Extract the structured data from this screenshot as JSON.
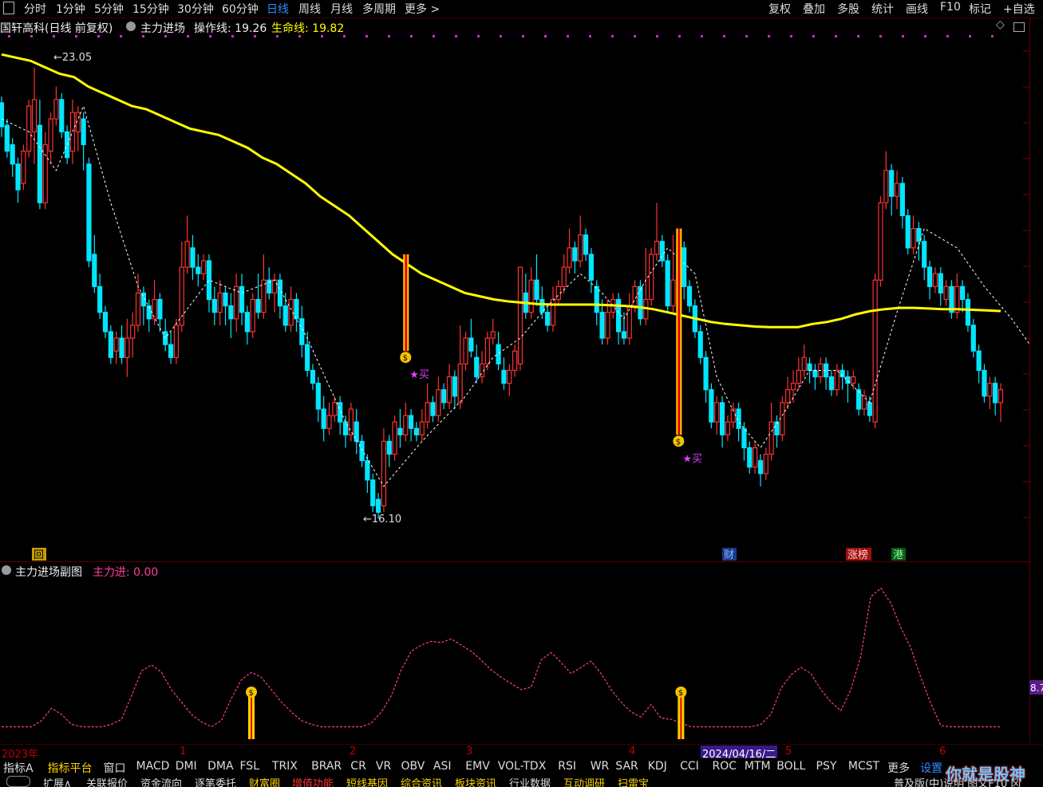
{
  "topbar": {
    "menu_icon": "square-menu-icon",
    "periods": [
      "分时",
      "1分钟",
      "5分钟",
      "15分钟",
      "30分钟",
      "60分钟",
      "日线",
      "周线",
      "月线",
      "多周期",
      "更多 >"
    ],
    "selected": "日线",
    "right": [
      "复权",
      "叠加",
      "多股",
      "统计",
      "画线",
      "F10",
      "标记",
      "+自选"
    ]
  },
  "info": {
    "stock": "国轩高科(日线 前复权)",
    "indicator": "主力进场",
    "op_line": "操作线: 19.26",
    "life_line": "生命线: 19.82"
  },
  "chart_data": {
    "type": "candlestick",
    "price_high_label": "23.05",
    "price_low_label": "16.10",
    "buy_label": "★买",
    "markers": [
      "回",
      "财",
      "涨榜",
      "港"
    ],
    "date_label": "2024/04/16/二",
    "months": [
      "2023年",
      "1",
      "2",
      "3",
      "4",
      "5",
      "6"
    ],
    "sub_title": "主力进场副图",
    "sub_value": "主力进: 0.00",
    "sub_axis_label": "8.7",
    "candles": [
      [
        22.55,
        22.18,
        22.65,
        22.02
      ],
      [
        22.2,
        21.8,
        22.3,
        21.7
      ],
      [
        21.9,
        21.6,
        22.0,
        21.4
      ],
      [
        21.6,
        21.2,
        21.7,
        21.0
      ],
      [
        21.3,
        21.8,
        21.9,
        21.2
      ],
      [
        21.8,
        22.5,
        22.6,
        21.7
      ],
      [
        22.1,
        22.6,
        23.1,
        21.6
      ],
      [
        22.2,
        21.0,
        22.6,
        20.9
      ],
      [
        21.0,
        21.9,
        22.1,
        20.9
      ],
      [
        21.8,
        22.3,
        22.4,
        21.6
      ],
      [
        22.3,
        22.6,
        22.8,
        22.2
      ],
      [
        22.6,
        22.1,
        22.7,
        22.0
      ],
      [
        22.1,
        21.7,
        22.2,
        21.6
      ],
      [
        21.8,
        22.4,
        22.6,
        21.6
      ],
      [
        22.1,
        22.4,
        22.5,
        21.8
      ],
      [
        22.3,
        21.9,
        22.4,
        21.5
      ],
      [
        21.6,
        20.1,
        21.7,
        20.0
      ],
      [
        20.2,
        19.7,
        20.5,
        19.6
      ],
      [
        19.7,
        19.3,
        19.9,
        19.2
      ],
      [
        19.3,
        19.0,
        19.4,
        18.9
      ],
      [
        19.0,
        18.6,
        19.1,
        18.5
      ],
      [
        18.7,
        18.9,
        19.0,
        18.5
      ],
      [
        18.9,
        18.6,
        19.1,
        18.5
      ],
      [
        18.6,
        18.9,
        19.2,
        18.3
      ],
      [
        18.9,
        19.1,
        19.3,
        18.6
      ],
      [
        19.1,
        19.6,
        19.9,
        19.0
      ],
      [
        19.6,
        19.4,
        19.7,
        19.1
      ],
      [
        19.4,
        19.2,
        19.5,
        19.0
      ],
      [
        19.2,
        19.5,
        19.8,
        19.1
      ],
      [
        19.5,
        19.2,
        19.6,
        19.0
      ],
      [
        19.0,
        18.8,
        19.2,
        18.7
      ],
      [
        18.8,
        18.6,
        19.0,
        18.5
      ],
      [
        18.6,
        19.1,
        19.2,
        18.5
      ],
      [
        19.1,
        20.0,
        20.4,
        19.0
      ],
      [
        20.0,
        20.4,
        20.8,
        19.9
      ],
      [
        20.3,
        20.0,
        20.5,
        19.8
      ],
      [
        20.0,
        19.9,
        20.2,
        19.7
      ],
      [
        19.9,
        20.1,
        20.2,
        19.8
      ],
      [
        20.1,
        19.5,
        20.2,
        19.3
      ],
      [
        19.5,
        19.3,
        19.7,
        19.1
      ],
      [
        19.3,
        19.6,
        19.8,
        19.1
      ],
      [
        19.6,
        19.4,
        19.7,
        19.1
      ],
      [
        19.4,
        19.2,
        19.6,
        18.9
      ],
      [
        19.2,
        19.7,
        19.9,
        19.0
      ],
      [
        19.7,
        19.3,
        19.9,
        19.1
      ],
      [
        19.3,
        19.0,
        19.4,
        18.8
      ],
      [
        19.0,
        19.5,
        19.6,
        18.9
      ],
      [
        19.5,
        19.3,
        19.9,
        19.2
      ],
      [
        19.3,
        19.8,
        20.2,
        19.2
      ],
      [
        19.8,
        19.6,
        20.0,
        19.5
      ],
      [
        19.6,
        19.8,
        19.9,
        19.3
      ],
      [
        19.8,
        19.4,
        19.9,
        19.2
      ],
      [
        19.4,
        19.1,
        19.6,
        19.0
      ],
      [
        19.1,
        19.5,
        19.7,
        19.0
      ],
      [
        19.5,
        19.2,
        19.6,
        19.0
      ],
      [
        19.2,
        18.8,
        19.4,
        18.6
      ],
      [
        18.8,
        18.4,
        19.0,
        18.3
      ],
      [
        18.4,
        18.2,
        18.5,
        18.1
      ],
      [
        18.2,
        17.8,
        18.3,
        17.6
      ],
      [
        17.8,
        17.5,
        18.0,
        17.3
      ],
      [
        17.5,
        17.7,
        17.9,
        17.4
      ],
      [
        17.7,
        17.9,
        18.0,
        17.6
      ],
      [
        17.9,
        17.6,
        18.0,
        17.4
      ],
      [
        17.6,
        17.4,
        17.7,
        17.2
      ],
      [
        17.4,
        17.8,
        17.9,
        17.3
      ],
      [
        17.6,
        17.3,
        17.8,
        17.1
      ],
      [
        17.3,
        17.0,
        17.4,
        16.9
      ],
      [
        17.0,
        16.7,
        17.1,
        16.5
      ],
      [
        16.7,
        16.3,
        16.8,
        16.2
      ],
      [
        16.4,
        16.2,
        16.5,
        16.1
      ],
      [
        16.3,
        17.3,
        17.5,
        16.2
      ],
      [
        17.3,
        17.1,
        17.4,
        16.9
      ],
      [
        17.1,
        17.6,
        17.7,
        17.0
      ],
      [
        17.5,
        17.4,
        17.8,
        17.2
      ],
      [
        17.4,
        17.7,
        17.9,
        17.3
      ],
      [
        17.7,
        17.5,
        17.8,
        17.3
      ],
      [
        17.5,
        17.4,
        17.6,
        17.3
      ],
      [
        17.4,
        17.6,
        17.8,
        17.3
      ],
      [
        17.6,
        17.9,
        18.2,
        17.5
      ],
      [
        17.9,
        17.7,
        18.0,
        17.6
      ],
      [
        17.7,
        18.1,
        18.3,
        17.6
      ],
      [
        18.1,
        17.9,
        18.2,
        17.8
      ],
      [
        17.9,
        18.3,
        18.5,
        17.8
      ],
      [
        18.3,
        18.0,
        18.4,
        17.8
      ],
      [
        17.9,
        18.5,
        19.1,
        17.8
      ],
      [
        18.5,
        18.9,
        19.0,
        18.4
      ],
      [
        18.9,
        18.7,
        19.2,
        18.6
      ],
      [
        18.6,
        18.3,
        18.8,
        18.2
      ],
      [
        18.3,
        18.5,
        18.7,
        18.2
      ],
      [
        18.5,
        18.9,
        19.0,
        18.4
      ],
      [
        18.9,
        19.0,
        19.2,
        18.8
      ],
      [
        18.8,
        18.5,
        19.0,
        18.4
      ],
      [
        18.4,
        18.2,
        18.6,
        18.1
      ],
      [
        18.2,
        18.4,
        18.5,
        18.0
      ],
      [
        18.4,
        18.7,
        18.8,
        18.3
      ],
      [
        18.5,
        20.0,
        20.0,
        18.4
      ],
      [
        19.6,
        19.3,
        19.9,
        19.2
      ],
      [
        19.3,
        19.8,
        20.0,
        19.2
      ],
      [
        19.8,
        19.5,
        20.2,
        19.4
      ],
      [
        19.5,
        19.3,
        19.7,
        19.2
      ],
      [
        19.3,
        19.1,
        19.4,
        19.0
      ],
      [
        19.1,
        19.5,
        19.7,
        19.0
      ],
      [
        19.5,
        19.7,
        19.8,
        19.4
      ],
      [
        19.7,
        20.0,
        20.2,
        19.6
      ],
      [
        20.0,
        20.3,
        20.6,
        19.9
      ],
      [
        20.3,
        20.1,
        20.4,
        19.9
      ],
      [
        20.1,
        20.5,
        20.8,
        20.0
      ],
      [
        20.5,
        20.2,
        20.6,
        20.1
      ],
      [
        20.2,
        19.8,
        20.3,
        19.6
      ],
      [
        19.7,
        19.3,
        19.8,
        19.1
      ],
      [
        19.3,
        18.9,
        19.5,
        18.8
      ],
      [
        18.9,
        19.3,
        19.5,
        18.8
      ],
      [
        19.3,
        19.5,
        19.6,
        19.2
      ],
      [
        19.5,
        19.0,
        19.6,
        18.8
      ],
      [
        19.0,
        18.9,
        19.3,
        18.8
      ],
      [
        18.9,
        19.4,
        19.6,
        18.8
      ],
      [
        19.4,
        19.7,
        19.8,
        19.3
      ],
      [
        19.7,
        19.2,
        19.8,
        19.1
      ],
      [
        19.2,
        19.5,
        20.3,
        19.1
      ],
      [
        19.5,
        20.2,
        20.3,
        19.4
      ],
      [
        20.2,
        20.4,
        21.0,
        20.1
      ],
      [
        20.4,
        20.1,
        20.5,
        20.0
      ],
      [
        20.1,
        19.4,
        20.2,
        19.3
      ],
      [
        19.4,
        19.8,
        20.5,
        19.3
      ],
      [
        19.8,
        20.3,
        20.5,
        19.7
      ],
      [
        20.3,
        19.7,
        20.4,
        19.5
      ],
      [
        19.7,
        19.4,
        19.8,
        19.3
      ],
      [
        19.4,
        19.0,
        19.5,
        18.9
      ],
      [
        19.0,
        18.6,
        19.1,
        18.5
      ],
      [
        18.6,
        18.1,
        18.7,
        17.9
      ],
      [
        18.1,
        17.6,
        18.2,
        17.5
      ],
      [
        17.6,
        17.9,
        18.0,
        17.4
      ],
      [
        17.9,
        17.4,
        18.0,
        17.2
      ],
      [
        17.4,
        17.6,
        17.7,
        17.3
      ],
      [
        17.6,
        17.8,
        17.9,
        17.5
      ],
      [
        17.8,
        17.5,
        17.9,
        17.3
      ],
      [
        17.5,
        17.2,
        17.6,
        17.0
      ],
      [
        17.2,
        16.9,
        17.3,
        16.8
      ],
      [
        16.9,
        17.2,
        17.3,
        16.8
      ],
      [
        17.0,
        16.8,
        17.1,
        16.6
      ],
      [
        16.8,
        17.1,
        17.2,
        16.7
      ],
      [
        17.1,
        17.6,
        17.9,
        17.0
      ],
      [
        17.6,
        17.4,
        17.7,
        17.2
      ],
      [
        17.4,
        17.9,
        18.0,
        17.3
      ],
      [
        17.9,
        18.1,
        18.3,
        17.8
      ],
      [
        18.1,
        18.2,
        18.4,
        17.9
      ],
      [
        18.2,
        18.4,
        18.6,
        18.1
      ],
      [
        18.4,
        18.6,
        18.8,
        18.3
      ],
      [
        18.5,
        18.4,
        18.6,
        18.2
      ],
      [
        18.4,
        18.3,
        18.5,
        18.1
      ],
      [
        18.3,
        18.5,
        18.6,
        18.2
      ],
      [
        18.5,
        18.3,
        18.6,
        18.1
      ],
      [
        18.3,
        18.1,
        18.4,
        18.0
      ],
      [
        18.1,
        18.4,
        18.5,
        18.0
      ],
      [
        18.4,
        18.3,
        18.5,
        18.1
      ],
      [
        18.3,
        18.2,
        18.4,
        17.9
      ],
      [
        18.2,
        18.3,
        18.4,
        18.1
      ],
      [
        18.1,
        17.8,
        18.2,
        17.7
      ],
      [
        17.8,
        18.0,
        18.1,
        17.7
      ],
      [
        17.9,
        17.7,
        18.0,
        17.6
      ],
      [
        17.6,
        19.8,
        19.9,
        17.5
      ],
      [
        19.8,
        21.0,
        21.1,
        19.7
      ],
      [
        21.0,
        21.5,
        21.8,
        20.9
      ],
      [
        21.5,
        21.1,
        21.6,
        20.8
      ],
      [
        21.1,
        21.3,
        21.5,
        20.9
      ],
      [
        21.3,
        20.8,
        21.4,
        20.6
      ],
      [
        20.8,
        20.3,
        20.9,
        20.2
      ],
      [
        20.3,
        20.6,
        20.8,
        20.2
      ],
      [
        20.6,
        20.4,
        20.7,
        20.1
      ],
      [
        20.4,
        20.0,
        20.5,
        19.8
      ],
      [
        20.0,
        19.7,
        20.1,
        19.5
      ],
      [
        19.7,
        19.9,
        20.0,
        19.6
      ],
      [
        19.9,
        19.6,
        20.0,
        19.4
      ],
      [
        19.5,
        19.7,
        19.8,
        19.4
      ],
      [
        19.7,
        19.3,
        19.8,
        19.2
      ],
      [
        19.3,
        19.7,
        19.9,
        19.2
      ],
      [
        19.7,
        19.5,
        19.8,
        19.3
      ],
      [
        19.5,
        19.1,
        19.6,
        19.0
      ],
      [
        19.1,
        18.7,
        19.2,
        18.6
      ],
      [
        18.7,
        18.4,
        18.8,
        18.2
      ],
      [
        18.4,
        18.0,
        18.5,
        17.9
      ],
      [
        18.0,
        18.2,
        18.3,
        17.8
      ],
      [
        18.2,
        17.9,
        18.3,
        17.7
      ],
      [
        17.9,
        18.1,
        18.2,
        17.6
      ]
    ],
    "life_line_ma": [
      23.3,
      23.25,
      23.2,
      23.1,
      23.0,
      22.95,
      22.8,
      22.7,
      22.6,
      22.5,
      22.45,
      22.35,
      22.25,
      22.15,
      22.1,
      22.05,
      21.95,
      21.85,
      21.7,
      21.6,
      21.45,
      21.3,
      21.1,
      20.95,
      20.8,
      20.6,
      20.4,
      20.2,
      20.05,
      19.9,
      19.8,
      19.7,
      19.6,
      19.55,
      19.5,
      19.47,
      19.45,
      19.43,
      19.42,
      19.42,
      19.42,
      19.42,
      19.41,
      19.4,
      19.38,
      19.35,
      19.3,
      19.25,
      19.2,
      19.15,
      19.12,
      19.1,
      19.08,
      19.07,
      19.07,
      19.07,
      19.12,
      19.15,
      19.2,
      19.27,
      19.32,
      19.35,
      19.37,
      19.37,
      19.36,
      19.35,
      19.35,
      19.34,
      19.33,
      19.32
    ],
    "op_line_points": [
      [
        0,
        22.3
      ],
      [
        5,
        22.1
      ],
      [
        10,
        21.5
      ],
      [
        15,
        22.5
      ],
      [
        20,
        21.0
      ],
      [
        25,
        19.7
      ],
      [
        30,
        18.9
      ],
      [
        38,
        19.8
      ],
      [
        44,
        19.6
      ],
      [
        50,
        19.8
      ],
      [
        56,
        18.9
      ],
      [
        63,
        17.6
      ],
      [
        70,
        16.6
      ],
      [
        77,
        17.3
      ],
      [
        85,
        18.0
      ],
      [
        90,
        18.6
      ],
      [
        95,
        18.9
      ],
      [
        100,
        19.4
      ],
      [
        106,
        19.9
      ],
      [
        110,
        19.6
      ],
      [
        114,
        19.2
      ],
      [
        118,
        19.8
      ],
      [
        122,
        20.3
      ],
      [
        127,
        19.9
      ],
      [
        131,
        18.3
      ],
      [
        135,
        17.6
      ],
      [
        139,
        17.2
      ],
      [
        143,
        17.7
      ],
      [
        148,
        18.4
      ],
      [
        153,
        18.4
      ],
      [
        159,
        17.9
      ],
      [
        164,
        19.3
      ],
      [
        169,
        20.6
      ],
      [
        175,
        20.3
      ],
      [
        180,
        19.7
      ],
      [
        185,
        19.2
      ],
      [
        190,
        18.6
      ]
    ],
    "sub_curve": [
      1,
      1,
      1,
      1,
      1.5,
      2.5,
      2,
      1.2,
      1,
      1,
      1,
      1.2,
      1.6,
      3.5,
      5.5,
      6,
      5.4,
      4,
      3,
      2,
      1.4,
      1,
      1.5,
      3.3,
      4.8,
      5.4,
      5,
      4,
      3,
      2.2,
      1.5,
      1.2,
      1,
      1,
      1,
      1,
      1,
      1.3,
      2.2,
      3.5,
      5.6,
      7.1,
      7.6,
      7.9,
      7.8,
      8.1,
      7.6,
      7.1,
      6.4,
      5.6,
      5,
      4.5,
      4,
      4.2,
      6.4,
      7,
      6.2,
      5.3,
      5.8,
      6.3,
      5.3,
      4,
      3,
      2.2,
      1.8,
      2.8,
      1.7,
      1.6,
      1.3,
      1,
      1,
      1,
      1,
      1,
      1,
      1,
      1.2,
      2,
      4.1,
      5.2,
      5.8,
      5.3,
      4,
      3,
      2.3,
      4,
      6.7,
      11.5,
      12.2,
      11,
      9,
      7.4,
      5,
      2.9,
      1.1,
      1,
      1,
      1,
      1,
      1,
      1
    ],
    "sub_bars": [
      {
        "idx": 25,
        "label": "$"
      },
      {
        "idx": 68,
        "label": "$"
      }
    ]
  },
  "timeline": [
    "2023年",
    "1",
    "2",
    "3",
    "4",
    "2024/04/16/二",
    "5",
    "6"
  ],
  "tabs": [
    "指标A",
    "指标平台",
    "窗口",
    "MACD",
    "DMI",
    "DMA",
    "FSL",
    "TRIX",
    "BRAR",
    "CR",
    "VR",
    "OBV",
    "ASI",
    "EMV",
    "VOL-TDX",
    "RSI",
    "WR",
    "SAR",
    "KDJ",
    "CCI",
    "ROC",
    "MTM",
    "BOLL",
    "PSY",
    "MCST",
    "更多",
    "设置"
  ],
  "tabs2": [
    "扩展∧",
    "关联报价",
    "资金流向",
    "逐笔委托",
    "财富圈",
    "增值功能",
    "短线基因",
    "综合资讯",
    "板块资讯",
    "行业数据",
    "互动调研",
    "扫雷宝"
  ],
  "tabs2_right": "普及版(中)说明 图文F10 冈",
  "watermark": "你就是股神",
  "colors": {
    "up": "#ff3232",
    "down": "#00e6ff",
    "life": "#ffff00",
    "op": "#ffffff",
    "sub": "#ff3c96",
    "accent": "#2e8bff"
  }
}
